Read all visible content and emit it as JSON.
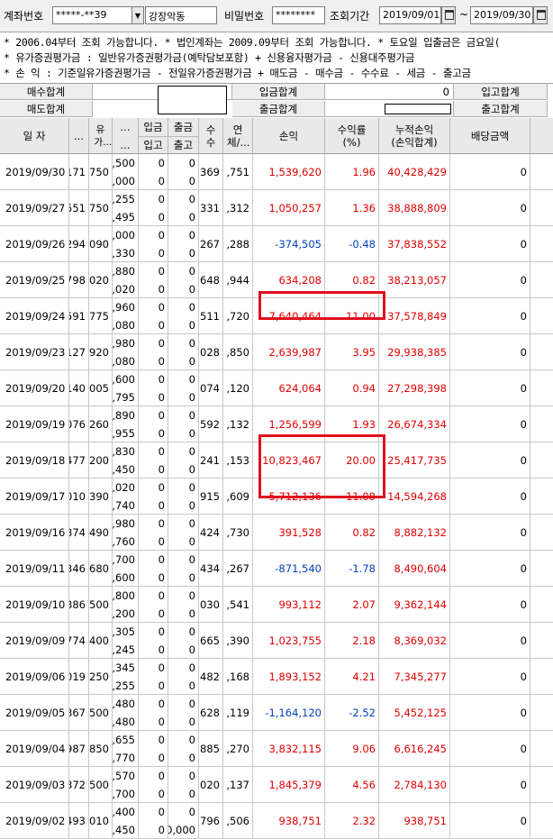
{
  "topbar": {
    "account_label": "계좌번호",
    "account_value": "*****-**39",
    "account_name": "강장악동",
    "password_label": "비밀번호",
    "password_value": "********",
    "period_label": "조회기간",
    "date_from": "2019/09/01",
    "tilde": "~",
    "date_to": "2019/09/30"
  },
  "notes": {
    "line1": "* 2006.04부터 조회 가능합니다.   * 법인계좌는 2009.09부터 조회 가능합니다.   * 토요일 입출금은 금요일(",
    "line2": "* 유가증권평가금 : 일반유가증권평가금(예탁담보포함) + 신용융자평가금 - 신용대주평가금",
    "line3": "* 손          익 : 기준일유가증권평가금 - 전일유가증권평가금 + 매도금 - 매수금 - 수수료 - 세금 - 출고금"
  },
  "summary": {
    "buy_total_label": "매수합계",
    "deposit_total_label": "입금합계",
    "deposit_total_value": "0",
    "in_total_label": "입고합계",
    "sell_total_label": "매도합계",
    "withdraw_total_label": "출금합계",
    "out_total_label": "출고합계"
  },
  "table": {
    "headers": {
      "date": "일 자",
      "c2": "...",
      "c3": "유가...",
      "c4a": "...",
      "c4b": "...",
      "deposit_a": "입금",
      "deposit_b": "입고",
      "withdraw_a": "출금",
      "withdraw_b": "출고",
      "c7": "수수",
      "c8": "연체/...",
      "pnl": "손익",
      "rate": "수익률\n(%)",
      "cum": "누적손익\n(손익합계)",
      "dividend": "배당금액"
    },
    "rows": [
      {
        "date": "2019/09/30",
        "c2": "171",
        "c3": "750",
        "c4a": ",500",
        "c4b": ",000",
        "dep_a": "0",
        "dep_b": "0",
        "wd_a": "0",
        "wd_b": "0",
        "c7": "369",
        "c8": ",751",
        "pnl": "1,539,620",
        "rate": "1.96",
        "cum": "40,428,429",
        "div": "0",
        "sign": "pos"
      },
      {
        "date": "2019/09/27",
        "c2": "551",
        "c3": "750",
        "c4a": ",255",
        "c4b": ",495",
        "dep_a": "0",
        "dep_b": "0",
        "wd_a": "0",
        "wd_b": "0",
        "c7": "331",
        "c8": ",312",
        "pnl": "1,050,257",
        "rate": "1.36",
        "cum": "38,888,809",
        "div": "0",
        "sign": "pos"
      },
      {
        "date": "2019/09/26",
        "c2": "294",
        "c3": "090",
        "c4a": ",000",
        "c4b": ",330",
        "dep_a": "0",
        "dep_b": "0",
        "wd_a": "0",
        "wd_b": "0",
        "c7": "267",
        "c8": ",288",
        "pnl": "-374,505",
        "rate": "-0.48",
        "cum": "37,838,552",
        "div": "0",
        "sign": "neg"
      },
      {
        "date": "2019/09/25",
        "c2": "798",
        "c3": "020",
        "c4a": ",880",
        "c4b": ",020",
        "dep_a": "0",
        "dep_b": "0",
        "wd_a": "0",
        "wd_b": "0",
        "c7": "648",
        "c8": ",944",
        "pnl": "634,208",
        "rate": "0.82",
        "cum": "38,213,057",
        "div": "0",
        "sign": "pos"
      },
      {
        "date": "2019/09/24",
        "c2": "591",
        "c3": "775",
        "c4a": ",960",
        "c4b": ",080",
        "dep_a": "0",
        "dep_b": "0",
        "wd_a": "0",
        "wd_b": "0",
        "c7": "511",
        "c8": ",720",
        "pnl": "7,640,464",
        "rate": "11.00",
        "cum": "37,578,849",
        "div": "0",
        "sign": "pos"
      },
      {
        "date": "2019/09/23",
        "c2": "127",
        "c3": "920",
        "c4a": ",980",
        "c4b": ",080",
        "dep_a": "0",
        "dep_b": "0",
        "wd_a": "0",
        "wd_b": "0",
        "c7": "028",
        "c8": ",850",
        "pnl": "2,639,987",
        "rate": "3.95",
        "cum": "29,938,385",
        "div": "0",
        "sign": "pos"
      },
      {
        "date": "2019/09/20",
        "c2": "140",
        "c3": "005",
        "c4a": ",600",
        "c4b": ",795",
        "dep_a": "0",
        "dep_b": "0",
        "wd_a": "0",
        "wd_b": "0",
        "c7": "074",
        "c8": ",120",
        "pnl": "624,064",
        "rate": "0.94",
        "cum": "27,298,398",
        "div": "0",
        "sign": "pos"
      },
      {
        "date": "2019/09/19",
        "c2": "076",
        "c3": "260",
        "c4a": ",890",
        "c4b": ",955",
        "dep_a": "0",
        "dep_b": "0",
        "wd_a": "0",
        "wd_b": "0",
        "c7": "592",
        "c8": ",132",
        "pnl": "1,256,599",
        "rate": "1.93",
        "cum": "26,674,334",
        "div": "0",
        "sign": "pos"
      },
      {
        "date": "2019/09/18",
        "c2": "477",
        "c3": "200",
        "c4a": ",830",
        "c4b": ",450",
        "dep_a": "0",
        "dep_b": "0",
        "wd_a": "0",
        "wd_b": "0",
        "c7": "241",
        "c8": ",153",
        "pnl": "10,823,467",
        "rate": "20.00",
        "cum": "25,417,735",
        "div": "0",
        "sign": "pos"
      },
      {
        "date": "2019/09/17",
        "c2": "010",
        "c3": "390",
        "c4a": ",020",
        "c4b": ",740",
        "dep_a": "0",
        "dep_b": "0",
        "wd_a": "0",
        "wd_b": "0",
        "c7": "915",
        "c8": ",609",
        "pnl": "5,712,136",
        "rate": "11.08",
        "cum": "14,594,268",
        "div": "0",
        "sign": "pos"
      },
      {
        "date": "2019/09/16",
        "c2": "874",
        "c3": "490",
        "c4a": ",980",
        "c4b": ",760",
        "dep_a": "0",
        "dep_b": "0",
        "wd_a": "0",
        "wd_b": "0",
        "c7": "424",
        "c8": ",730",
        "pnl": "391,528",
        "rate": "0.82",
        "cum": "8,882,132",
        "div": "0",
        "sign": "pos"
      },
      {
        "date": "2019/09/11",
        "c2": "346",
        "c3": "680",
        "c4a": ",700",
        "c4b": ",600",
        "dep_a": "0",
        "dep_b": "0",
        "wd_a": "0",
        "wd_b": "0",
        "c7": "434",
        "c8": ",267",
        "pnl": "-871,540",
        "rate": "-1.78",
        "cum": "8,490,604",
        "div": "0",
        "sign": "neg"
      },
      {
        "date": "2019/09/10",
        "c2": "886",
        "c3": "500",
        "c4a": ",800",
        "c4b": ",200",
        "dep_a": "0",
        "dep_b": "0",
        "wd_a": "0",
        "wd_b": "0",
        "c7": "030",
        "c8": ",541",
        "pnl": "993,112",
        "rate": "2.07",
        "cum": "9,362,144",
        "div": "0",
        "sign": "pos"
      },
      {
        "date": "2019/09/09",
        "c2": "774",
        "c3": "400",
        "c4a": ",305",
        "c4b": ",245",
        "dep_a": "0",
        "dep_b": "0",
        "wd_a": "0",
        "wd_b": "0",
        "c7": "665",
        "c8": ",390",
        "pnl": "1,023,755",
        "rate": "2.18",
        "cum": "8,369,032",
        "div": "0",
        "sign": "pos"
      },
      {
        "date": "2019/09/06",
        "c2": "019",
        "c3": "250",
        "c4a": ",345",
        "c4b": ",255",
        "dep_a": "0",
        "dep_b": "0",
        "wd_a": "0",
        "wd_b": "0",
        "c7": "482",
        "c8": ",168",
        "pnl": "1,893,152",
        "rate": "4.21",
        "cum": "7,345,277",
        "div": "0",
        "sign": "pos"
      },
      {
        "date": "2019/09/05",
        "c2": "867",
        "c3": "500",
        "c4a": ",480",
        "c4b": ",480",
        "dep_a": "0",
        "dep_b": "0",
        "wd_a": "0",
        "wd_b": "0",
        "c7": "628",
        "c8": ",119",
        "pnl": "-1,164,120",
        "rate": "-2.52",
        "cum": "5,452,125",
        "div": "0",
        "sign": "neg"
      },
      {
        "date": "2019/09/04",
        "c2": "987",
        "c3": "850",
        "c4a": ",655",
        "c4b": ",770",
        "dep_a": "0",
        "dep_b": "0",
        "wd_a": "0",
        "wd_b": "0",
        "c7": "885",
        "c8": ",270",
        "pnl": "3,832,115",
        "rate": "9.06",
        "cum": "6,616,245",
        "div": "0",
        "sign": "pos"
      },
      {
        "date": "2019/09/03",
        "c2": "872",
        "c3": "500",
        "c4a": ",570",
        "c4b": ",700",
        "dep_a": "0",
        "dep_b": "0",
        "wd_a": "0",
        "wd_b": "0",
        "c7": "020",
        "c8": ",137",
        "pnl": "1,845,379",
        "rate": "4.56",
        "cum": "2,784,130",
        "div": "0",
        "sign": "pos"
      },
      {
        "date": "2019/09/02",
        "c2": "493",
        "c3": "010",
        "c4a": ",400",
        "c4b": ",450",
        "dep_a": "0",
        "dep_b": "0",
        "wd_a": "0",
        "wd_b": "0,000",
        "c7": "796",
        "c8": ",506",
        "pnl": "938,751",
        "rate": "2.32",
        "cum": "938,751",
        "div": "0",
        "sign": "pos"
      }
    ]
  },
  "colors": {
    "positive": "#e00000",
    "negative": "#0040c0",
    "highlight": "#e0101e"
  }
}
